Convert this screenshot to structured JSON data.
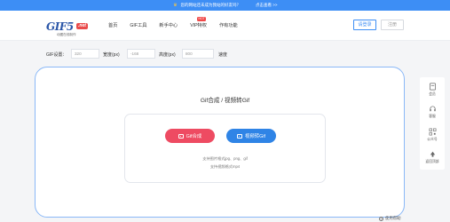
{
  "banner": {
    "text": "您的网站还未成为我站的好友吗？",
    "link": "点击查看 >>"
  },
  "logo": {
    "main": "GIF5",
    "badge": ".net",
    "sub": "动图在线制作"
  },
  "nav": {
    "items": [
      "首页",
      "GIF工具",
      "新手中心",
      "VIP特权",
      "作有功能"
    ],
    "hot_badge": "HOT"
  },
  "auth": {
    "login": "请登录",
    "register": "注册"
  },
  "settings": {
    "gif_label": "GIF设置：",
    "width_value": "320",
    "width_label": "宽度(px)",
    "height_value": "-168",
    "height_label": "高度(px)",
    "speed_value": "800",
    "speed_label": "速度"
  },
  "main": {
    "title": "Gif合成 / 视频转Gif",
    "gif_button": "Gif合成",
    "video_button": "视频转Gif",
    "support_images": "支持图片格式jpg、png、gif",
    "support_video": "支持视频格式mp4"
  },
  "help": "使用帮助",
  "sidebar": {
    "items": [
      "会员",
      "客服",
      "公众号",
      "返回顶部"
    ]
  },
  "colors": {
    "accent": "#3d8ef5",
    "gif_button": "#ee4b62",
    "video_button": "#2f84e6"
  }
}
